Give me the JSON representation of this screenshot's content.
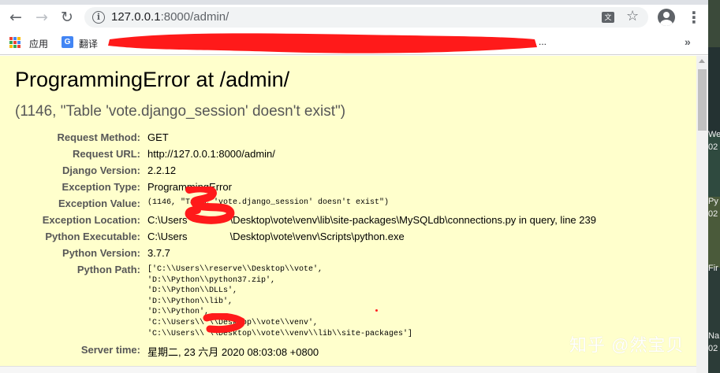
{
  "browser": {
    "url_host": "127.0.0.1",
    "url_path": ":8000/admin/",
    "translate_badge": "文",
    "bookmarks": {
      "apps_label": "应用",
      "translate_label": "翻译",
      "ellipsis": "...",
      "more": "»"
    },
    "colors": {
      "accent": "#4285f4",
      "icon": "#5f6368"
    }
  },
  "error_page": {
    "title": "ProgrammingError at /admin/",
    "subtitle": "(1146, \"Table 'vote.django_session' doesn't exist\")",
    "background": "#ffffcc",
    "meta": [
      {
        "label": "Request Method:",
        "value": "GET"
      },
      {
        "label": "Request URL:",
        "value": "http://127.0.0.1:8000/admin/"
      },
      {
        "label": "Django Version:",
        "value": "2.2.12"
      },
      {
        "label": "Exception Type:",
        "value": "ProgrammingError"
      },
      {
        "label": "Exception Value:",
        "value": "(1146, \"Table 'vote.django_session' doesn't exist\")"
      },
      {
        "label": "Exception Location:",
        "value_prefix": "C:\\Users",
        "value_suffix": "\\Desktop\\vote\\venv\\lib\\site-packages\\MySQLdb\\connections.py in query, line 239"
      },
      {
        "label": "Python Executable:",
        "value_prefix": "C:\\Users",
        "value_suffix": "\\Desktop\\vote\\venv\\Scripts\\python.exe"
      },
      {
        "label": "Python Version:",
        "value": "3.7.7"
      },
      {
        "label": "Python Path:",
        "lines": [
          "['C:\\\\Users\\\\reserve\\\\Desktop\\\\vote',",
          " 'D:\\\\Python\\\\python37.zip',",
          " 'D:\\\\Python\\\\DLLs',",
          " 'D:\\\\Python\\\\lib',",
          " 'D:\\\\Python',",
          " 'C:\\\\Users\\\\          \\\\Desktop\\\\vote\\\\venv',",
          " 'C:\\\\Users\\\\          \\\\Desktop\\\\vote\\\\venv\\\\lib\\\\site-packages']"
        ]
      },
      {
        "label": "Server time:",
        "value": "星期二, 23 六月 2020 08:03:08 +0800"
      }
    ]
  },
  "side_window": {
    "snippets": [
      "We",
      "02",
      "Py",
      "02",
      "Fir",
      "Na",
      "02"
    ]
  },
  "watermark": "知乎 @然宝贝"
}
